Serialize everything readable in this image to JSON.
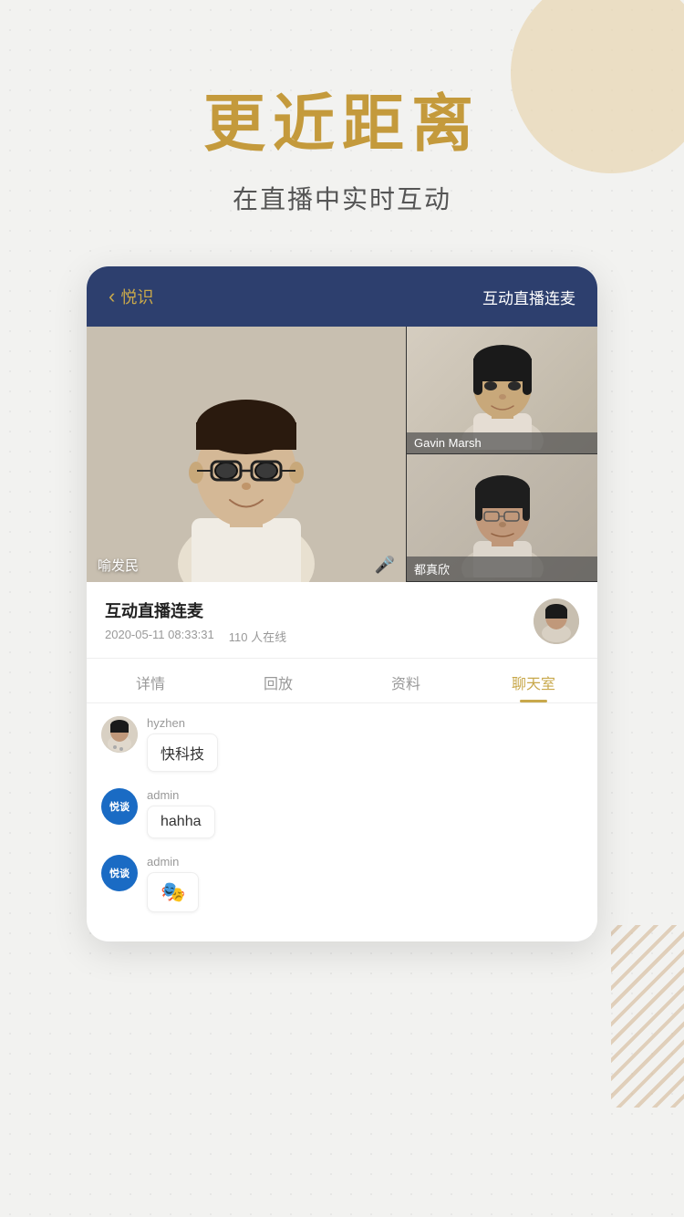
{
  "background": {
    "color": "#f2f2f0"
  },
  "headline": "更近距离",
  "subtitle": "在直播中实时互动",
  "card": {
    "header": {
      "back_label": "悦识",
      "live_label": "互动直播连麦"
    },
    "video": {
      "main_person_name": "喻发民",
      "side_person_1_name": "Gavin Marsh",
      "side_person_2_name": "都真欣"
    },
    "info": {
      "title": "互动直播连麦",
      "date": "2020-05-11 08:33:31",
      "online": "110 人在线"
    },
    "tabs": [
      {
        "label": "详情",
        "active": false
      },
      {
        "label": "回放",
        "active": false
      },
      {
        "label": "资料",
        "active": false
      },
      {
        "label": "聊天室",
        "active": true
      }
    ],
    "chat": [
      {
        "username": "hyzhen",
        "avatar_type": "photo",
        "message": "快科技",
        "is_emoji": false
      },
      {
        "username": "admin",
        "avatar_type": "logo",
        "message": "hahha",
        "is_emoji": false
      },
      {
        "username": "admin",
        "avatar_type": "logo",
        "message": "🎭",
        "is_emoji": true
      }
    ]
  },
  "icons": {
    "back_chevron": "‹",
    "mic": "🎤",
    "logo_text": "悦谈"
  }
}
